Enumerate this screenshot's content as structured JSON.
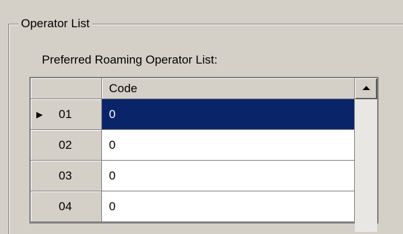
{
  "groupbox": {
    "title": "Operator List"
  },
  "grid": {
    "label": "Preferred Roaming Operator List:",
    "column_header": "Code",
    "rows": [
      {
        "num": "01",
        "code": "0",
        "selected": true
      },
      {
        "num": "02",
        "code": "0",
        "selected": false
      },
      {
        "num": "03",
        "code": "0",
        "selected": false
      },
      {
        "num": "04",
        "code": "0",
        "selected": false
      }
    ],
    "selection_color": "#0a246a"
  },
  "icons": {
    "current_row": "triangle-right-icon",
    "scroll_up": "scroll-up-arrow-icon"
  }
}
